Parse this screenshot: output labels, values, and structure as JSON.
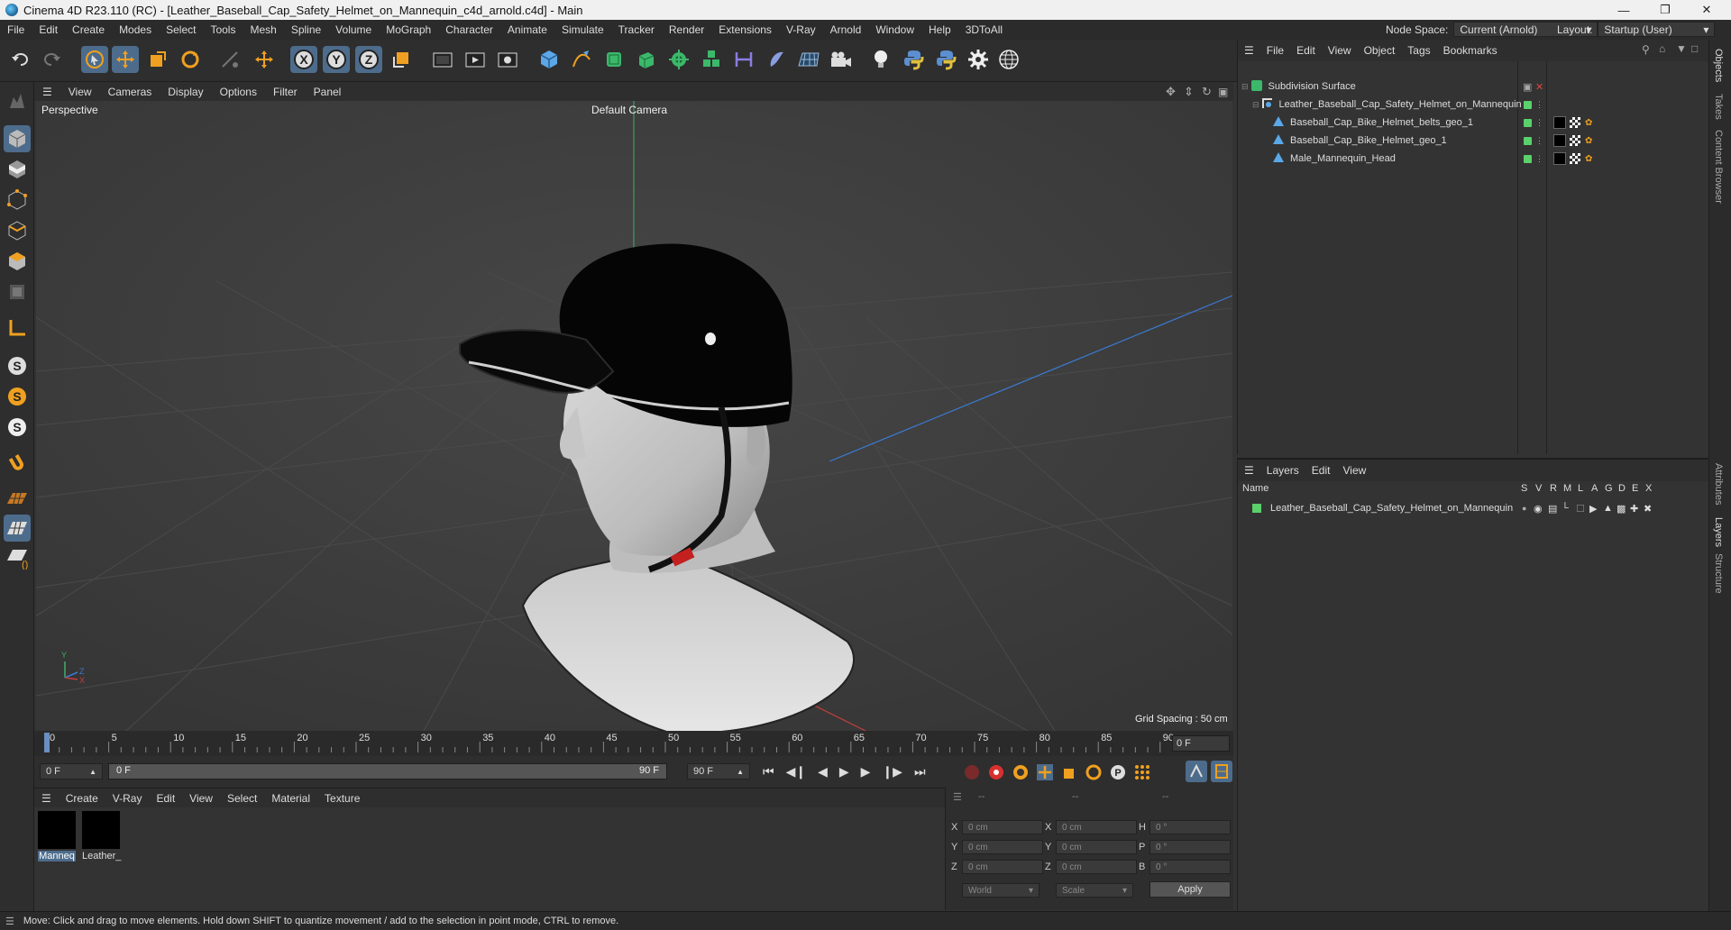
{
  "window": {
    "title": "Cinema 4D R23.110 (RC) - [Leather_Baseball_Cap_Safety_Helmet_on_Mannequin_c4d_arnold.c4d] - Main"
  },
  "menubar": {
    "items": [
      "File",
      "Edit",
      "Create",
      "Modes",
      "Select",
      "Tools",
      "Mesh",
      "Spline",
      "Volume",
      "MoGraph",
      "Character",
      "Animate",
      "Simulate",
      "Tracker",
      "Render",
      "Extensions",
      "V-Ray",
      "Arnold",
      "Window",
      "Help",
      "3DToAll"
    ],
    "node_space_label": "Node Space:",
    "node_space_value": "Current (Arnold)",
    "layout_label": "Layout:",
    "layout_value": "Startup (User)"
  },
  "viewport": {
    "menu": [
      "View",
      "Cameras",
      "Display",
      "Options",
      "Filter",
      "Panel"
    ],
    "view_name": "Perspective",
    "camera": "Default Camera",
    "grid_spacing": "Grid Spacing : 50 cm"
  },
  "timeline": {
    "ticks": [
      "0",
      "5",
      "10",
      "15",
      "20",
      "25",
      "30",
      "35",
      "40",
      "45",
      "50",
      "55",
      "60",
      "65",
      "70",
      "75",
      "80",
      "85",
      "90"
    ],
    "current_frame": "0 F"
  },
  "transport": {
    "start": "0 F",
    "range_start": "0 F",
    "range_end": "90 F",
    "end": "90 F"
  },
  "materials": {
    "menu": [
      "Create",
      "V-Ray",
      "Edit",
      "View",
      "Select",
      "Material",
      "Texture"
    ],
    "items": [
      "Manneq",
      "Leather_"
    ]
  },
  "coords": {
    "header": [
      "--",
      "--",
      "--"
    ],
    "rows": [
      {
        "a": "X",
        "av": "0 cm",
        "b": "X",
        "bv": "0 cm",
        "c": "H",
        "cv": "0 °"
      },
      {
        "a": "Y",
        "av": "0 cm",
        "b": "Y",
        "bv": "0 cm",
        "c": "P",
        "cv": "0 °"
      },
      {
        "a": "Z",
        "av": "0 cm",
        "b": "Z",
        "bv": "0 cm",
        "c": "B",
        "cv": "0 °"
      }
    ],
    "world": "World",
    "scale": "Scale",
    "apply": "Apply"
  },
  "objects": {
    "menu": [
      "File",
      "Edit",
      "View",
      "Object",
      "Tags",
      "Bookmarks"
    ],
    "tree": [
      "Subdivision Surface",
      "Leather_Baseball_Cap_Safety_Helmet_on_Mannequin",
      "Baseball_Cap_Bike_Helmet_belts_geo_1",
      "Baseball_Cap_Bike_Helmet_geo_1",
      "Male_Mannequin_Head"
    ]
  },
  "layers": {
    "menu": [
      "Layers",
      "Edit",
      "View"
    ],
    "name_col": "Name",
    "flags": [
      "S",
      "V",
      "R",
      "M",
      "L",
      "A",
      "G",
      "D",
      "E",
      "X"
    ],
    "items": [
      "Leather_Baseball_Cap_Safety_Helmet_on_Mannequin"
    ]
  },
  "side_tabs": [
    "Objects",
    "Takes",
    "Content Browser",
    "Attributes",
    "Layers",
    "Structure"
  ],
  "status": "Move: Click and drag to move elements. Hold down SHIFT to quantize movement / add to the selection in point mode, CTRL to remove.",
  "colors": {
    "accent": "#4d6c8c",
    "green": "#5ad16b",
    "bg": "#333333"
  }
}
